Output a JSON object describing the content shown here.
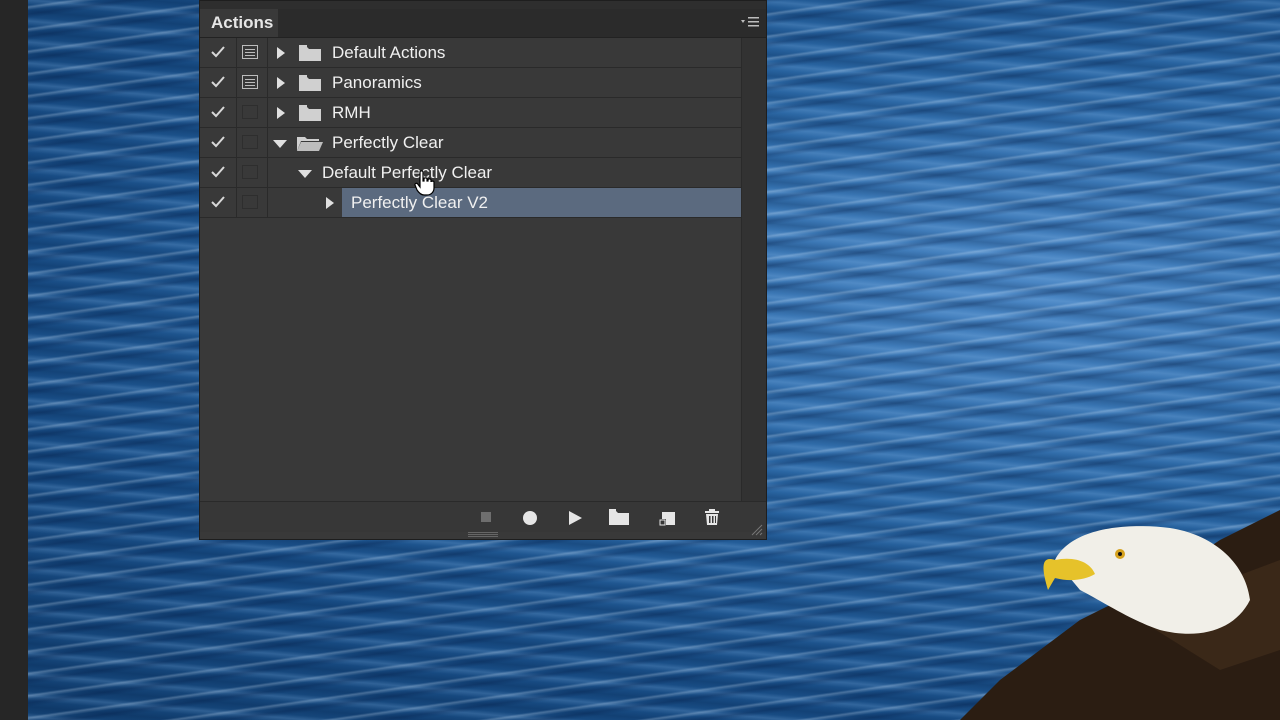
{
  "panel": {
    "tab_label": "Actions"
  },
  "actions": [
    {
      "label": "Default Actions",
      "checked": true,
      "dialog": true,
      "expanded": false,
      "type": "set"
    },
    {
      "label": "Panoramics",
      "checked": true,
      "dialog": true,
      "expanded": false,
      "type": "set"
    },
    {
      "label": "RMH",
      "checked": true,
      "dialog": false,
      "expanded": false,
      "type": "set"
    },
    {
      "label": "Perfectly Clear",
      "checked": true,
      "dialog": false,
      "expanded": true,
      "type": "set"
    },
    {
      "label": "Default Perfectly Clear",
      "checked": true,
      "dialog": false,
      "expanded": true,
      "type": "action"
    },
    {
      "label": "Perfectly Clear V2",
      "checked": true,
      "dialog": false,
      "expanded": false,
      "type": "step",
      "selected": true
    }
  ],
  "footer_buttons": [
    "stop-button",
    "record-button",
    "play-button",
    "new-set-button",
    "new-action-button",
    "delete-button"
  ],
  "colors": {
    "panel_bg": "#393939",
    "selection": "#5b6a7f",
    "text": "#f0f0f0"
  }
}
